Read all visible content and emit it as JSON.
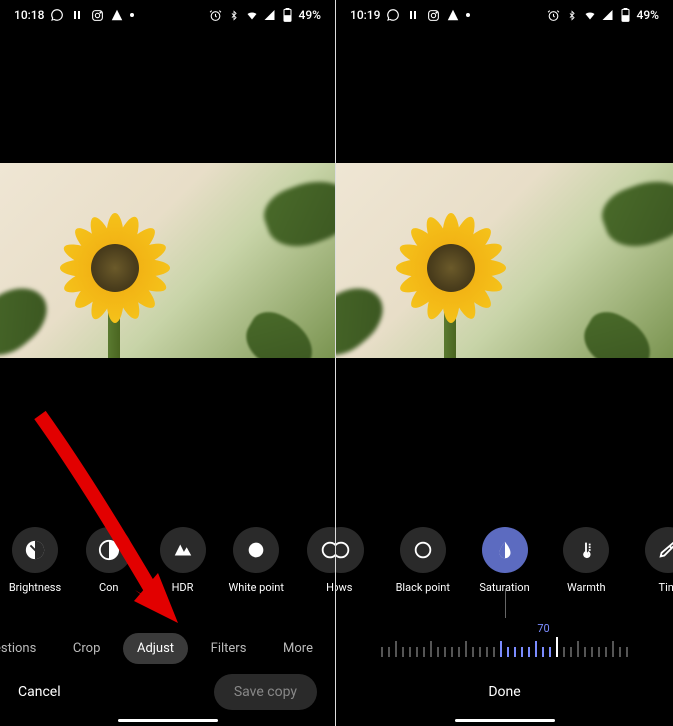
{
  "left": {
    "status": {
      "time": "10:18",
      "battery": "49%"
    },
    "adjust_items": [
      {
        "label": "Brightness",
        "icon": "brightness"
      },
      {
        "label": "Con",
        "icon": "contrast"
      },
      {
        "label": "HDR",
        "icon": "hdr"
      },
      {
        "label": "White point",
        "icon": "whitepoint"
      },
      {
        "label": "H",
        "icon": "highlights"
      }
    ],
    "tabs": {
      "suggestions": "estions",
      "crop": "Crop",
      "adjust": "Adjust",
      "filters": "Filters",
      "more": "More"
    },
    "buttons": {
      "cancel": "Cancel",
      "save": "Save copy"
    }
  },
  "right": {
    "status": {
      "time": "10:19",
      "battery": "49%"
    },
    "adjust_items": [
      {
        "label": "lows",
        "icon": "shadows"
      },
      {
        "label": "Black point",
        "icon": "blackpoint"
      },
      {
        "label": "Saturation",
        "icon": "saturation",
        "active": true
      },
      {
        "label": "Warmth",
        "icon": "warmth"
      },
      {
        "label": "Tint",
        "icon": "tint"
      }
    ],
    "slider": {
      "value": "70"
    },
    "buttons": {
      "done": "Done"
    }
  }
}
